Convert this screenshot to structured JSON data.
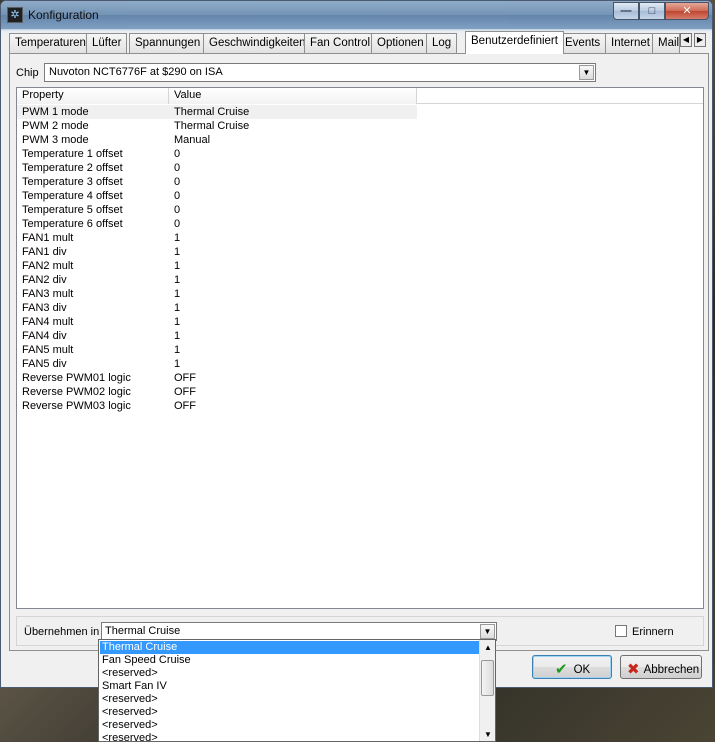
{
  "window": {
    "title": "Konfiguration",
    "min_glyph": "—",
    "max_glyph": "□",
    "close_glyph": "✕"
  },
  "tabs": [
    {
      "label": "Temperaturen"
    },
    {
      "label": "Lüfter"
    },
    {
      "label": "Spannungen"
    },
    {
      "label": "Geschwindigkeiten"
    },
    {
      "label": "Fan Control"
    },
    {
      "label": "Optionen"
    },
    {
      "label": "Log"
    },
    {
      "label": "Benutzerdefiniert"
    },
    {
      "label": "Events"
    },
    {
      "label": "Internet"
    },
    {
      "label": "Mail"
    }
  ],
  "chip": {
    "label": "Chip",
    "value": "Nuvoton NCT6776F at $290 on ISA"
  },
  "grid": {
    "headers": {
      "property": "Property",
      "value": "Value"
    },
    "rows": [
      {
        "property": "PWM 1 mode",
        "value": "Thermal Cruise"
      },
      {
        "property": "PWM 2 mode",
        "value": "Thermal Cruise"
      },
      {
        "property": "PWM 3 mode",
        "value": "Manual"
      },
      {
        "property": "Temperature 1 offset",
        "value": "0"
      },
      {
        "property": "Temperature 2 offset",
        "value": "0"
      },
      {
        "property": "Temperature 3 offset",
        "value": "0"
      },
      {
        "property": "Temperature 4 offset",
        "value": "0"
      },
      {
        "property": "Temperature 5 offset",
        "value": "0"
      },
      {
        "property": "Temperature 6 offset",
        "value": "0"
      },
      {
        "property": "FAN1 mult",
        "value": "1"
      },
      {
        "property": "FAN1 div",
        "value": "1"
      },
      {
        "property": "FAN2 mult",
        "value": "1"
      },
      {
        "property": "FAN2 div",
        "value": "1"
      },
      {
        "property": "FAN3 mult",
        "value": "1"
      },
      {
        "property": "FAN3 div",
        "value": "1"
      },
      {
        "property": "FAN4 mult",
        "value": "1"
      },
      {
        "property": "FAN4 div",
        "value": "1"
      },
      {
        "property": "FAN5 mult",
        "value": "1"
      },
      {
        "property": "FAN5 div",
        "value": "1"
      },
      {
        "property": "Reverse PWM01 logic",
        "value": "OFF"
      },
      {
        "property": "Reverse PWM02 logic",
        "value": "OFF"
      },
      {
        "property": "Reverse PWM03 logic",
        "value": "OFF"
      }
    ]
  },
  "apply": {
    "label": "Übernehmen in",
    "value": "Thermal Cruise",
    "remember_label": "Erinnern"
  },
  "dropdown": {
    "options": [
      "Thermal Cruise",
      "Fan Speed Cruise",
      "<reserved>",
      "Smart Fan IV",
      "<reserved>",
      "<reserved>",
      "<reserved>",
      "<reserved>"
    ]
  },
  "buttons": {
    "ok": "OK",
    "cancel": "Abbrechen"
  },
  "colors": {
    "selection": "#3399ff",
    "ok_icon": "#1c9a1c",
    "cancel_icon": "#c8281c"
  }
}
